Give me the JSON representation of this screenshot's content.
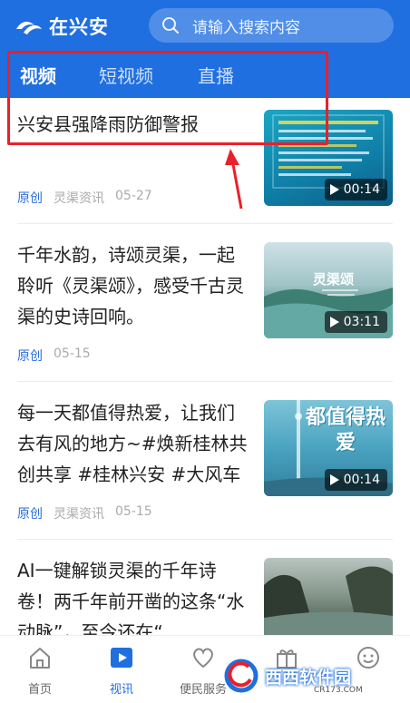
{
  "app": {
    "name": "在兴安"
  },
  "search": {
    "placeholder": "请输入搜索内容"
  },
  "tabs": [
    {
      "label": "视频",
      "active": true
    },
    {
      "label": "短视频",
      "active": false
    },
    {
      "label": "直播",
      "active": false
    }
  ],
  "feed": [
    {
      "title": "兴安县强降雨防御警报",
      "tag": "原创",
      "source": "灵渠资讯",
      "date": "05-27",
      "duration": "00:14"
    },
    {
      "title": "千年水韵，诗颂灵渠，一起聆听《灵渠颂》，感受千古灵渠的史诗回响。",
      "tag": "原创",
      "source": "",
      "date": "05-15",
      "duration": "03:11",
      "thumb_text": "灵渠颂"
    },
    {
      "title": "每一天都值得热爱，让我们去有风的地方~#焕新桂林共创共享 #桂林兴安 #大风车",
      "tag": "原创",
      "source": "灵渠资讯",
      "date": "05-15",
      "duration": "00:14",
      "thumb_text": "都值得热爱"
    },
    {
      "title": "AI一键解锁灵渠的千年诗卷！两千年前开凿的这条“水动脉”，至今还在“…",
      "tag": "",
      "source": "",
      "date": "",
      "duration": ""
    }
  ],
  "bottom_nav": [
    {
      "label": "首页",
      "icon": "home-icon",
      "active": false
    },
    {
      "label": "视讯",
      "icon": "video-icon",
      "active": true
    },
    {
      "label": "便民服务",
      "icon": "service-icon",
      "active": false
    },
    {
      "label": "",
      "icon": "gift-icon",
      "active": false
    },
    {
      "label": "",
      "icon": "profile-icon",
      "active": false
    }
  ],
  "watermark": {
    "text": "西西软件园",
    "sub": "CR173.COM"
  },
  "colors": {
    "brand": "#1f6fe0",
    "annotation": "#e8202a"
  }
}
